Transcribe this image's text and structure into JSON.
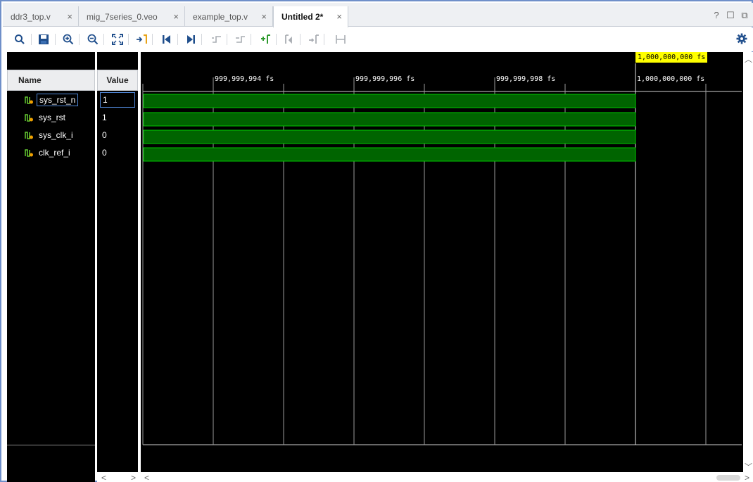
{
  "tabs": [
    {
      "label": "ddr3_top.v"
    },
    {
      "label": "mig_7series_0.veo"
    },
    {
      "label": "example_top.v"
    },
    {
      "label": "Untitled 2*"
    }
  ],
  "tab_close_glyph": "×",
  "window_controls": {
    "help": "?",
    "maximize": "☐",
    "undock": "⧉"
  },
  "toolbar_icons": [
    "search-icon",
    "save-icon",
    "zoom-in-icon",
    "zoom-out-icon",
    "zoom-fit-icon",
    "go-to-cursor-icon",
    "go-to-start-icon",
    "go-to-end-icon",
    "previous-transition-icon",
    "next-transition-icon",
    "add-marker-icon",
    "previous-marker-icon",
    "next-marker-icon",
    "swap-cursors-icon",
    "settings-icon"
  ],
  "headers": {
    "name": "Name",
    "value": "Value"
  },
  "signals": [
    {
      "name": "sys_rst_n",
      "value": "1"
    },
    {
      "name": "sys_rst",
      "value": "1"
    },
    {
      "name": "sys_clk_i",
      "value": "0"
    },
    {
      "name": "clk_ref_i",
      "value": "0"
    }
  ],
  "timeline": {
    "ticks": [
      "999,999,994 fs",
      "999,999,996 fs",
      "999,999,998 fs",
      "1,000,000,000 fs"
    ],
    "cursor_label": "1,000,000,000 fs"
  },
  "colors": {
    "wave_fill": "#006400",
    "wave_edge": "#00c800",
    "background": "#000000",
    "cursor_label_bg": "#ffff00"
  },
  "scroll": {
    "left": "<",
    "right": ">",
    "up": "^",
    "down": "v"
  }
}
